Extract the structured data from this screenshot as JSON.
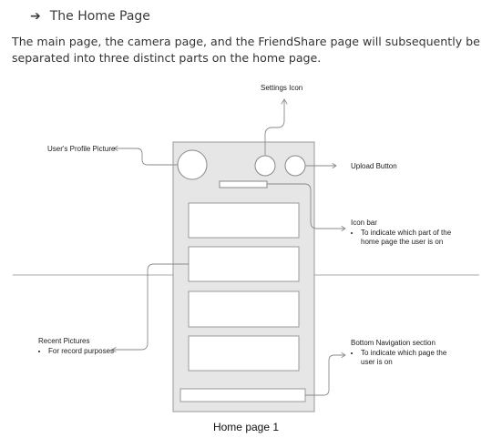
{
  "section": {
    "arrow": "➔",
    "title": "The Home Page",
    "intro": "The main page, the camera page, and the FriendShare page will subsequently be separated into three distinct parts on the home page."
  },
  "annotations": {
    "settings_icon": {
      "label": "Settings Icon"
    },
    "profile_picture": {
      "label": "User's Profile Picture"
    },
    "upload_button": {
      "label": "Upload Button"
    },
    "icon_bar": {
      "label": "Icon bar",
      "bullet": "To indicate which part of the home page the user is on"
    },
    "recent_pictures": {
      "label": "Recent Pictures",
      "bullet": "For record purposes"
    },
    "bottom_navigation": {
      "label": "Bottom Navigation section",
      "bullet": "To indicate which page the user is on"
    }
  },
  "caption": "Home page 1",
  "colors": {
    "phone_fill": "#e6e6e6",
    "phone_stroke": "#999999",
    "connector": "#8a8a8a",
    "card_fill": "#ffffff"
  }
}
